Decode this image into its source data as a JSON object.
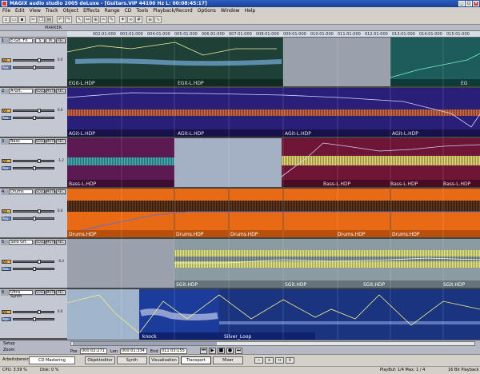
{
  "window": {
    "title": "MAGIX audio studio 2005 deLuxe - [Guitars.VIP   44100 Hz L: 00:08:45:17]"
  },
  "menu": [
    "File",
    "Edit",
    "View",
    "Track",
    "Object",
    "Effects",
    "Range",
    "CD",
    "Tools",
    "Playback/Record",
    "Options",
    "Window",
    "Help"
  ],
  "secondary_bar": {
    "label": "MARKER"
  },
  "ruler": {
    "labels": [
      "002:01:000",
      "003:01:000",
      "004:01:000",
      "005:01:000",
      "006:01:000",
      "007:01:000",
      "008:01:000",
      "009:01:000",
      "010:01:000",
      "011:01:000",
      "012:01:000",
      "013:01:000",
      "014:01:000",
      "015:01:000"
    ]
  },
  "tracks": [
    {
      "num": "1",
      "name": "E-Git. FX",
      "controls": [
        "S",
        "M",
        "REC"
      ],
      "db": "0.0",
      "objects": [
        "EGit-L.HDP",
        "EGit-L.HDP",
        "EG"
      ]
    },
    {
      "num": "2",
      "name": "A-Git.",
      "controls": [
        "SOLO",
        "MUTE",
        "REC"
      ],
      "db": "0.0",
      "objects": [
        "AGit-L.HDP",
        "AGit-L.HDP",
        "AGit-L.HDP",
        "AGit-L.HDP"
      ]
    },
    {
      "num": "3",
      "name": "Bass",
      "controls": [
        "SOLO",
        "MUTE",
        "REC"
      ],
      "db": "-1.2",
      "objects": [
        "Bass-L.HDP",
        "Bass-L.HDP",
        "Bass-L.HDP",
        "Bass-L.HDP"
      ]
    },
    {
      "num": "4",
      "name": "Drums",
      "controls": [
        "SOLO",
        "MUTE",
        "REC"
      ],
      "db": "0.0",
      "objects": [
        "Drums.HDP",
        "Drums.HDP",
        "Drums.HDP",
        "Drums.HDP",
        "Drums.HDP"
      ]
    },
    {
      "num": "5",
      "name": "Solo Git.",
      "controls": [
        "SOLO",
        "MUTE",
        "REC"
      ],
      "db": "-0.3",
      "objects": [
        "SGit.HDP",
        "SGit.HDP",
        "SGit.HDP",
        "SGit.HDP"
      ]
    },
    {
      "num": "6",
      "name": "Ultra Synth",
      "controls": [
        "SOLO",
        "MUTE",
        "REC"
      ],
      "db": "0.0",
      "objects": [
        "knock",
        "Silver_Loop"
      ]
    }
  ],
  "track_labels": {
    "vol": "Vol",
    "pan": "Pan"
  },
  "bottom": {
    "setup_label": "Setup",
    "zoom_label": "Zoom",
    "pos_label": "Pos",
    "pos_value": "000:02:271",
    "len_label": "Len",
    "len_value": "000:01:334",
    "end_label": "End",
    "end_value": "011:03:155"
  },
  "buttons": {
    "mastering": "CD Mastering",
    "objektedit": "Objekteditor",
    "synth": "Synth",
    "visualisation": "Visualisation",
    "transport": "Transport",
    "mixer": "Mixer",
    "preset_label": "Arbeitsbereich:"
  },
  "status": {
    "cpu": "CPU: 3.59 %",
    "disk": "Disk: 0 %",
    "playbuf": "PlayBuf: 1/4 Max: 1 / 4",
    "playback": "16 Bit Playback"
  },
  "colors": {
    "track1": "#1e4036",
    "track2": "#2a1f78",
    "track3": "#701860",
    "track4": "#e86a14",
    "track5": "#8a9ca2",
    "track6": "#1c3c9c"
  }
}
